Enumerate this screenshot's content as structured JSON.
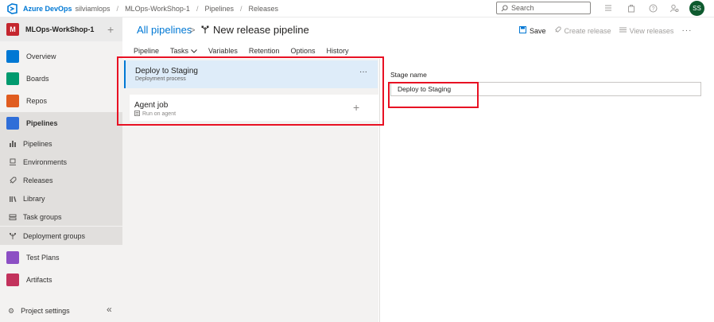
{
  "topbar": {
    "brand": "Azure DevOps",
    "org": "silviamlops",
    "breadcrumbs": [
      "MLOps-WorkShop-1",
      "Pipelines",
      "Releases"
    ],
    "search_placeholder": "Search",
    "avatar_initials": "SS"
  },
  "leftnav": {
    "project_badge": "M",
    "project_name": "MLOps-WorkShop-1",
    "items": [
      {
        "label": "Overview",
        "color": "#0078d4"
      },
      {
        "label": "Boards",
        "color": "#009a6e"
      },
      {
        "label": "Repos",
        "color": "#e05c1f"
      },
      {
        "label": "Pipelines",
        "color": "#2f6ed8"
      },
      {
        "label": "Test Plans",
        "color": "#8c4fc4"
      },
      {
        "label": "Artifacts",
        "color": "#c2325c"
      }
    ],
    "sub_items": [
      "Pipelines",
      "Environments",
      "Releases",
      "Library",
      "Task groups",
      "Deployment groups"
    ],
    "project_settings": "Project settings"
  },
  "header": {
    "all_pipelines": "All pipelines",
    "separator": ">",
    "title": "New release pipeline",
    "save": "Save",
    "create_release": "Create release",
    "view_releases": "View releases"
  },
  "tabs": [
    "Pipeline",
    "Tasks",
    "Variables",
    "Retention",
    "Options",
    "History"
  ],
  "stage": {
    "title": "Deploy to Staging",
    "subtitle": "Deployment process"
  },
  "job": {
    "title": "Agent job",
    "subtitle": "Run on agent"
  },
  "panel": {
    "stage_name_label": "Stage name",
    "stage_name_value": "Deploy to Staging"
  },
  "colors": {
    "accent": "#0078d4",
    "highlight_box": "#e81123",
    "selected_stage_bg": "#deecf9",
    "avatar_bg": "#0e5a2e",
    "project_badge": "#c4262e"
  }
}
